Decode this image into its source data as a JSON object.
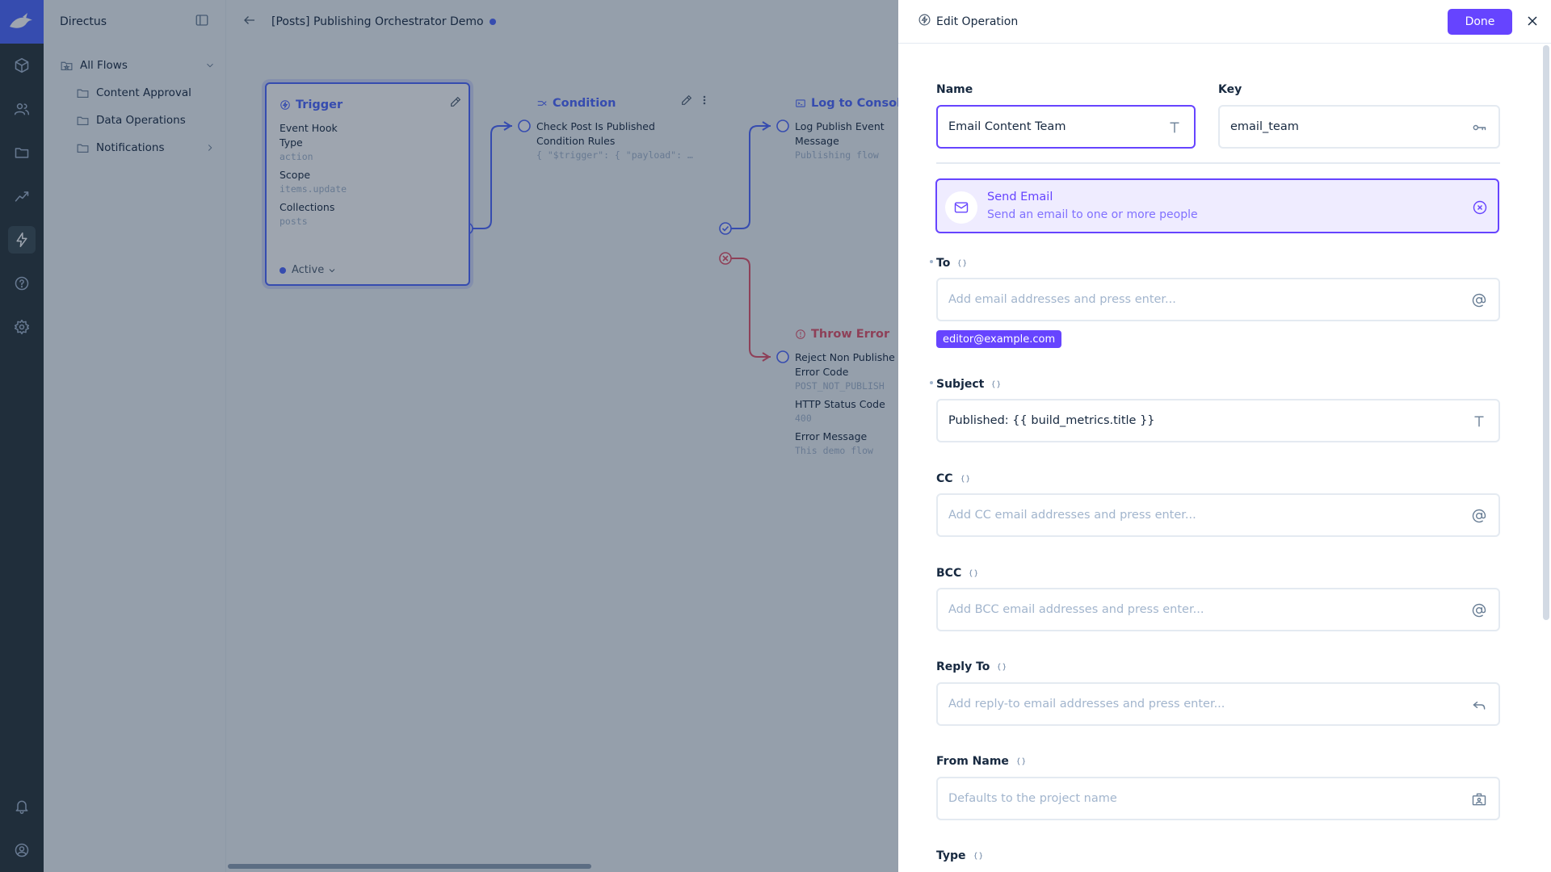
{
  "app": {
    "project_name": "Directus"
  },
  "nav": {
    "items": [
      {
        "label": "All Flows"
      },
      {
        "label": "Content Approval"
      },
      {
        "label": "Data Operations"
      },
      {
        "label": "Notifications"
      }
    ]
  },
  "header": {
    "title": "[Posts] Publishing Orchestrator Demo"
  },
  "canvas": {
    "trigger": {
      "title": "Trigger",
      "subtitle": "Event Hook",
      "fields": [
        {
          "label": "Type",
          "value": "action"
        },
        {
          "label": "Scope",
          "value": "items.update"
        },
        {
          "label": "Collections",
          "value": "posts"
        }
      ],
      "status": "Active"
    },
    "condition": {
      "title": "Condition",
      "subtitle": "Check Post Is Published",
      "fields": [
        {
          "label": "Condition Rules",
          "value": "{ \"$trigger\": { \"payload\": …"
        }
      ]
    },
    "log": {
      "title": "Log to Console",
      "subtitle": "Log Publish Event",
      "fields": [
        {
          "label": "Message",
          "value": "Publishing flow"
        }
      ]
    },
    "throw": {
      "title": "Throw Error",
      "subtitle": "Reject Non Publishe",
      "fields": [
        {
          "label": "Error Code",
          "value": "POST_NOT_PUBLISH"
        },
        {
          "label": "HTTP Status Code",
          "value": "400"
        },
        {
          "label": "Error Message",
          "value": "This demo flow"
        }
      ]
    }
  },
  "drawer": {
    "title": "Edit Operation",
    "done_label": "Done",
    "name": {
      "label": "Name",
      "value": "Email Content Team"
    },
    "key": {
      "label": "Key",
      "value": "email_team"
    },
    "operation": {
      "name": "Send Email",
      "description": "Send an email to one or more people"
    },
    "to": {
      "label": "To",
      "placeholder": "Add email addresses and press enter...",
      "chips": [
        "editor@example.com"
      ]
    },
    "subject": {
      "label": "Subject",
      "value": "Published: {{ build_metrics.title }}"
    },
    "cc": {
      "label": "CC",
      "placeholder": "Add CC email addresses and press enter..."
    },
    "bcc": {
      "label": "BCC",
      "placeholder": "Add BCC email addresses and press enter..."
    },
    "reply_to": {
      "label": "Reply To",
      "placeholder": "Add reply-to email addresses and press enter..."
    },
    "from_name": {
      "label": "From Name",
      "placeholder": "Defaults to the project name"
    },
    "type": {
      "label": "Type"
    }
  },
  "colors": {
    "accent": "#6644ff",
    "primary": "#4d66ff",
    "module_bar": "#263238",
    "danger": "#e35169"
  }
}
